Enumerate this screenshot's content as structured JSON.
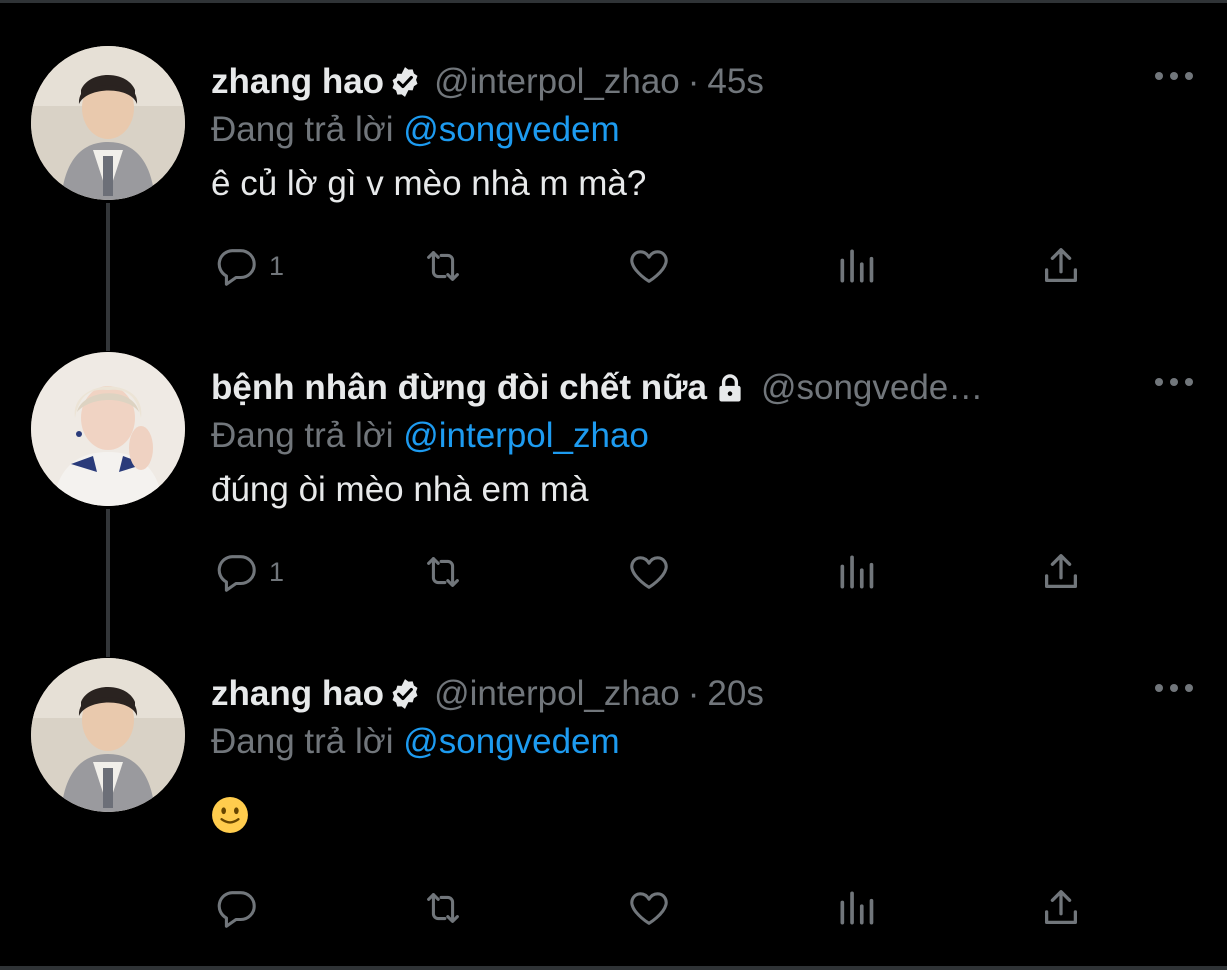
{
  "tweets": [
    {
      "name": "zhang hao",
      "verified": true,
      "handle": "@interpol_zhao",
      "time": "45s",
      "reply_prefix": "Đang trả lời",
      "reply_to": "@songvedem",
      "text": "ê củ lờ gì v mèo nhà m mà?",
      "reply_count": "1"
    },
    {
      "name": "bệnh nhân đừng đòi chết nữa",
      "protected": true,
      "handle": "@songvede…",
      "reply_prefix": "Đang trả lời",
      "reply_to": "@interpol_zhao",
      "text": "đúng òi mèo nhà em mà",
      "reply_count": "1"
    },
    {
      "name": "zhang hao",
      "verified": true,
      "handle": "@interpol_zhao",
      "time": "20s",
      "reply_prefix": "Đang trả lời",
      "reply_to": "@songvedem",
      "text": "🙂",
      "reply_count": ""
    }
  ],
  "separator": "·",
  "icons": [
    "more-icon",
    "reply-icon",
    "retweet-icon",
    "like-icon",
    "analytics-icon",
    "share-icon",
    "verified-badge-icon",
    "lock-icon"
  ],
  "colors": {
    "background": "#000000",
    "text": "#e7e9ea",
    "muted": "#71767b",
    "mention": "#1d9bf0"
  }
}
